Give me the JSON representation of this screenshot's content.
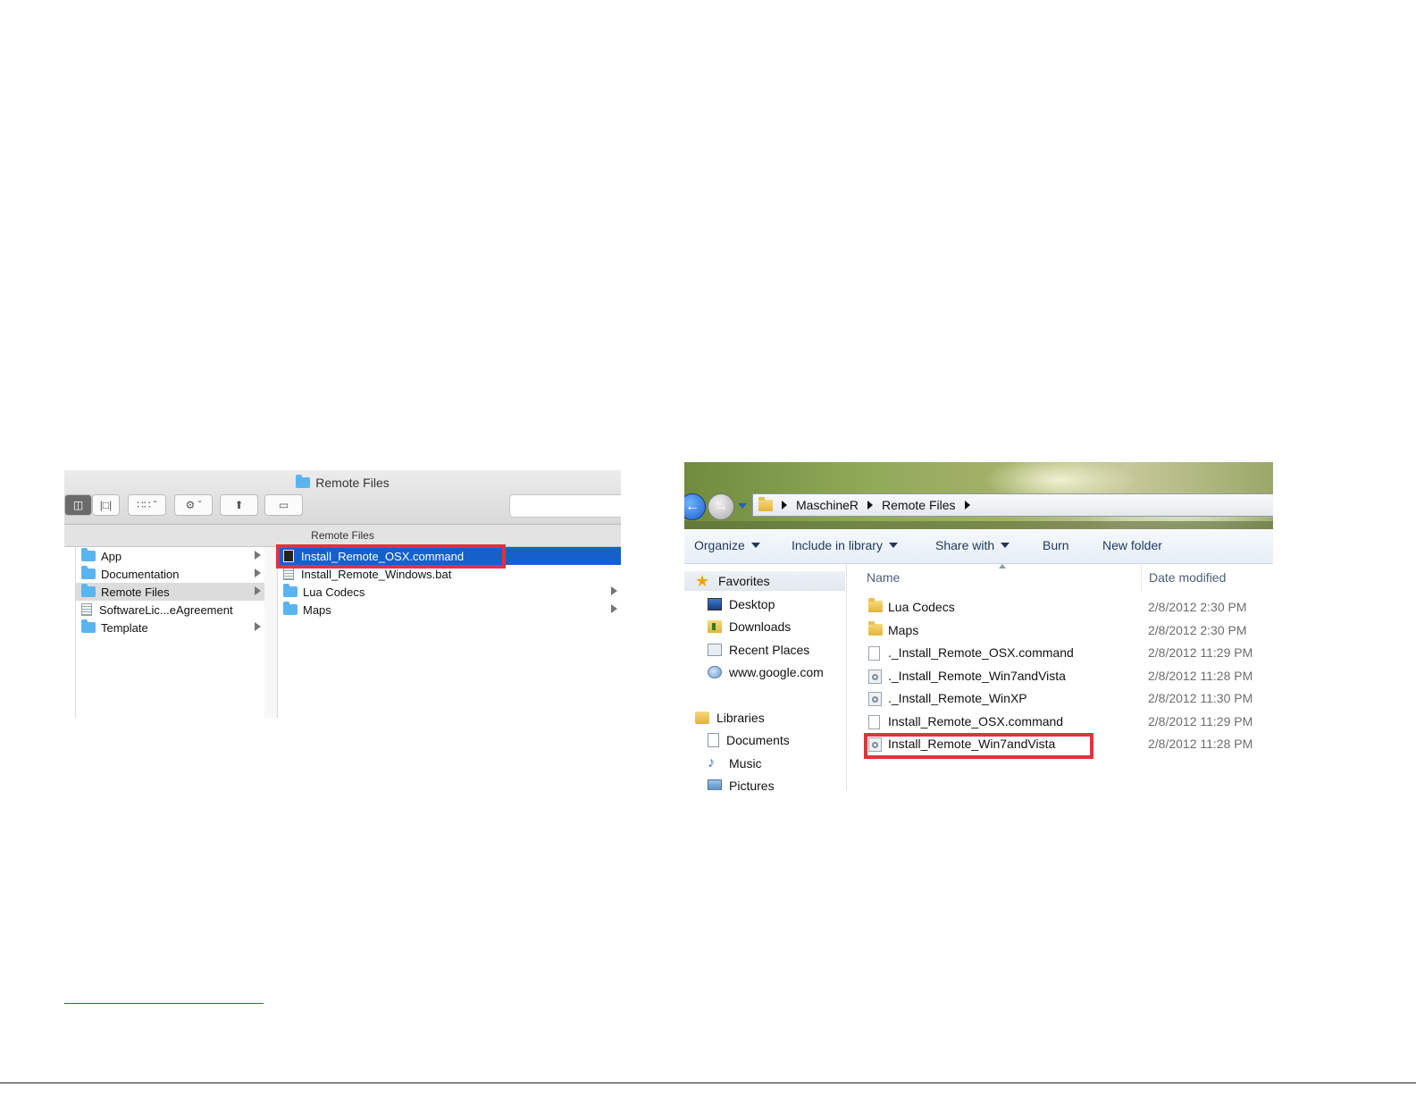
{
  "mac_finder": {
    "window_title": "Remote Files",
    "path_header": "Remote Files",
    "sidebar_items": [
      {
        "label": "App",
        "kind": "folder",
        "has_children": true,
        "selected": false
      },
      {
        "label": "Documentation",
        "kind": "folder",
        "has_children": true,
        "selected": false
      },
      {
        "label": "Remote Files",
        "kind": "folder",
        "has_children": true,
        "selected": true
      },
      {
        "label": "SoftwareLic...eAgreement",
        "kind": "document",
        "has_children": false,
        "selected": false
      },
      {
        "label": "Template",
        "kind": "folder",
        "has_children": true,
        "selected": false
      }
    ],
    "files": [
      {
        "label": "Install_Remote_OSX.command",
        "kind": "terminal",
        "highlighted": true
      },
      {
        "label": "Install_Remote_Windows.bat",
        "kind": "script",
        "highlighted": false
      },
      {
        "label": "Lua Codecs",
        "kind": "folder",
        "has_children": true
      },
      {
        "label": "Maps",
        "kind": "folder",
        "has_children": true
      }
    ],
    "icons": {
      "view_columns": "columns-view-icon",
      "view_coverflow": "coverflow-view-icon",
      "arrange": "arrange-grid-icon",
      "action": "gear-icon",
      "share": "share-icon",
      "tag": "tag-icon"
    }
  },
  "win_explorer": {
    "breadcrumb": [
      "MaschineR",
      "Remote Files"
    ],
    "commands": [
      "Organize",
      "Include in library",
      "Share with",
      "Burn",
      "New folder"
    ],
    "favorites_label": "Favorites",
    "favorites": [
      "Desktop",
      "Downloads",
      "Recent Places",
      "www.google.com"
    ],
    "libraries_label": "Libraries",
    "libraries": [
      "Documents",
      "Music",
      "Pictures"
    ],
    "columns": {
      "name": "Name",
      "date": "Date modified"
    },
    "files": [
      {
        "name": "Lua Codecs",
        "date": "2/8/2012 2:30 PM",
        "kind": "folder",
        "highlighted": false
      },
      {
        "name": "Maps",
        "date": "2/8/2012 2:30 PM",
        "kind": "folder",
        "highlighted": false
      },
      {
        "name": "._Install_Remote_OSX.command",
        "date": "2/8/2012 11:29 PM",
        "kind": "document",
        "highlighted": false
      },
      {
        "name": "._Install_Remote_Win7andVista",
        "date": "2/8/2012 11:28 PM",
        "kind": "batch",
        "highlighted": false
      },
      {
        "name": "._Install_Remote_WinXP",
        "date": "2/8/2012 11:30 PM",
        "kind": "batch",
        "highlighted": false
      },
      {
        "name": "Install_Remote_OSX.command",
        "date": "2/8/2012 11:29 PM",
        "kind": "document",
        "highlighted": false
      },
      {
        "name": "Install_Remote_Win7andVista",
        "date": "2/8/2012 11:28 PM",
        "kind": "batch",
        "highlighted": true
      }
    ],
    "colors": {
      "command_text": "#1e395b",
      "highlight": "#e0333b"
    }
  }
}
